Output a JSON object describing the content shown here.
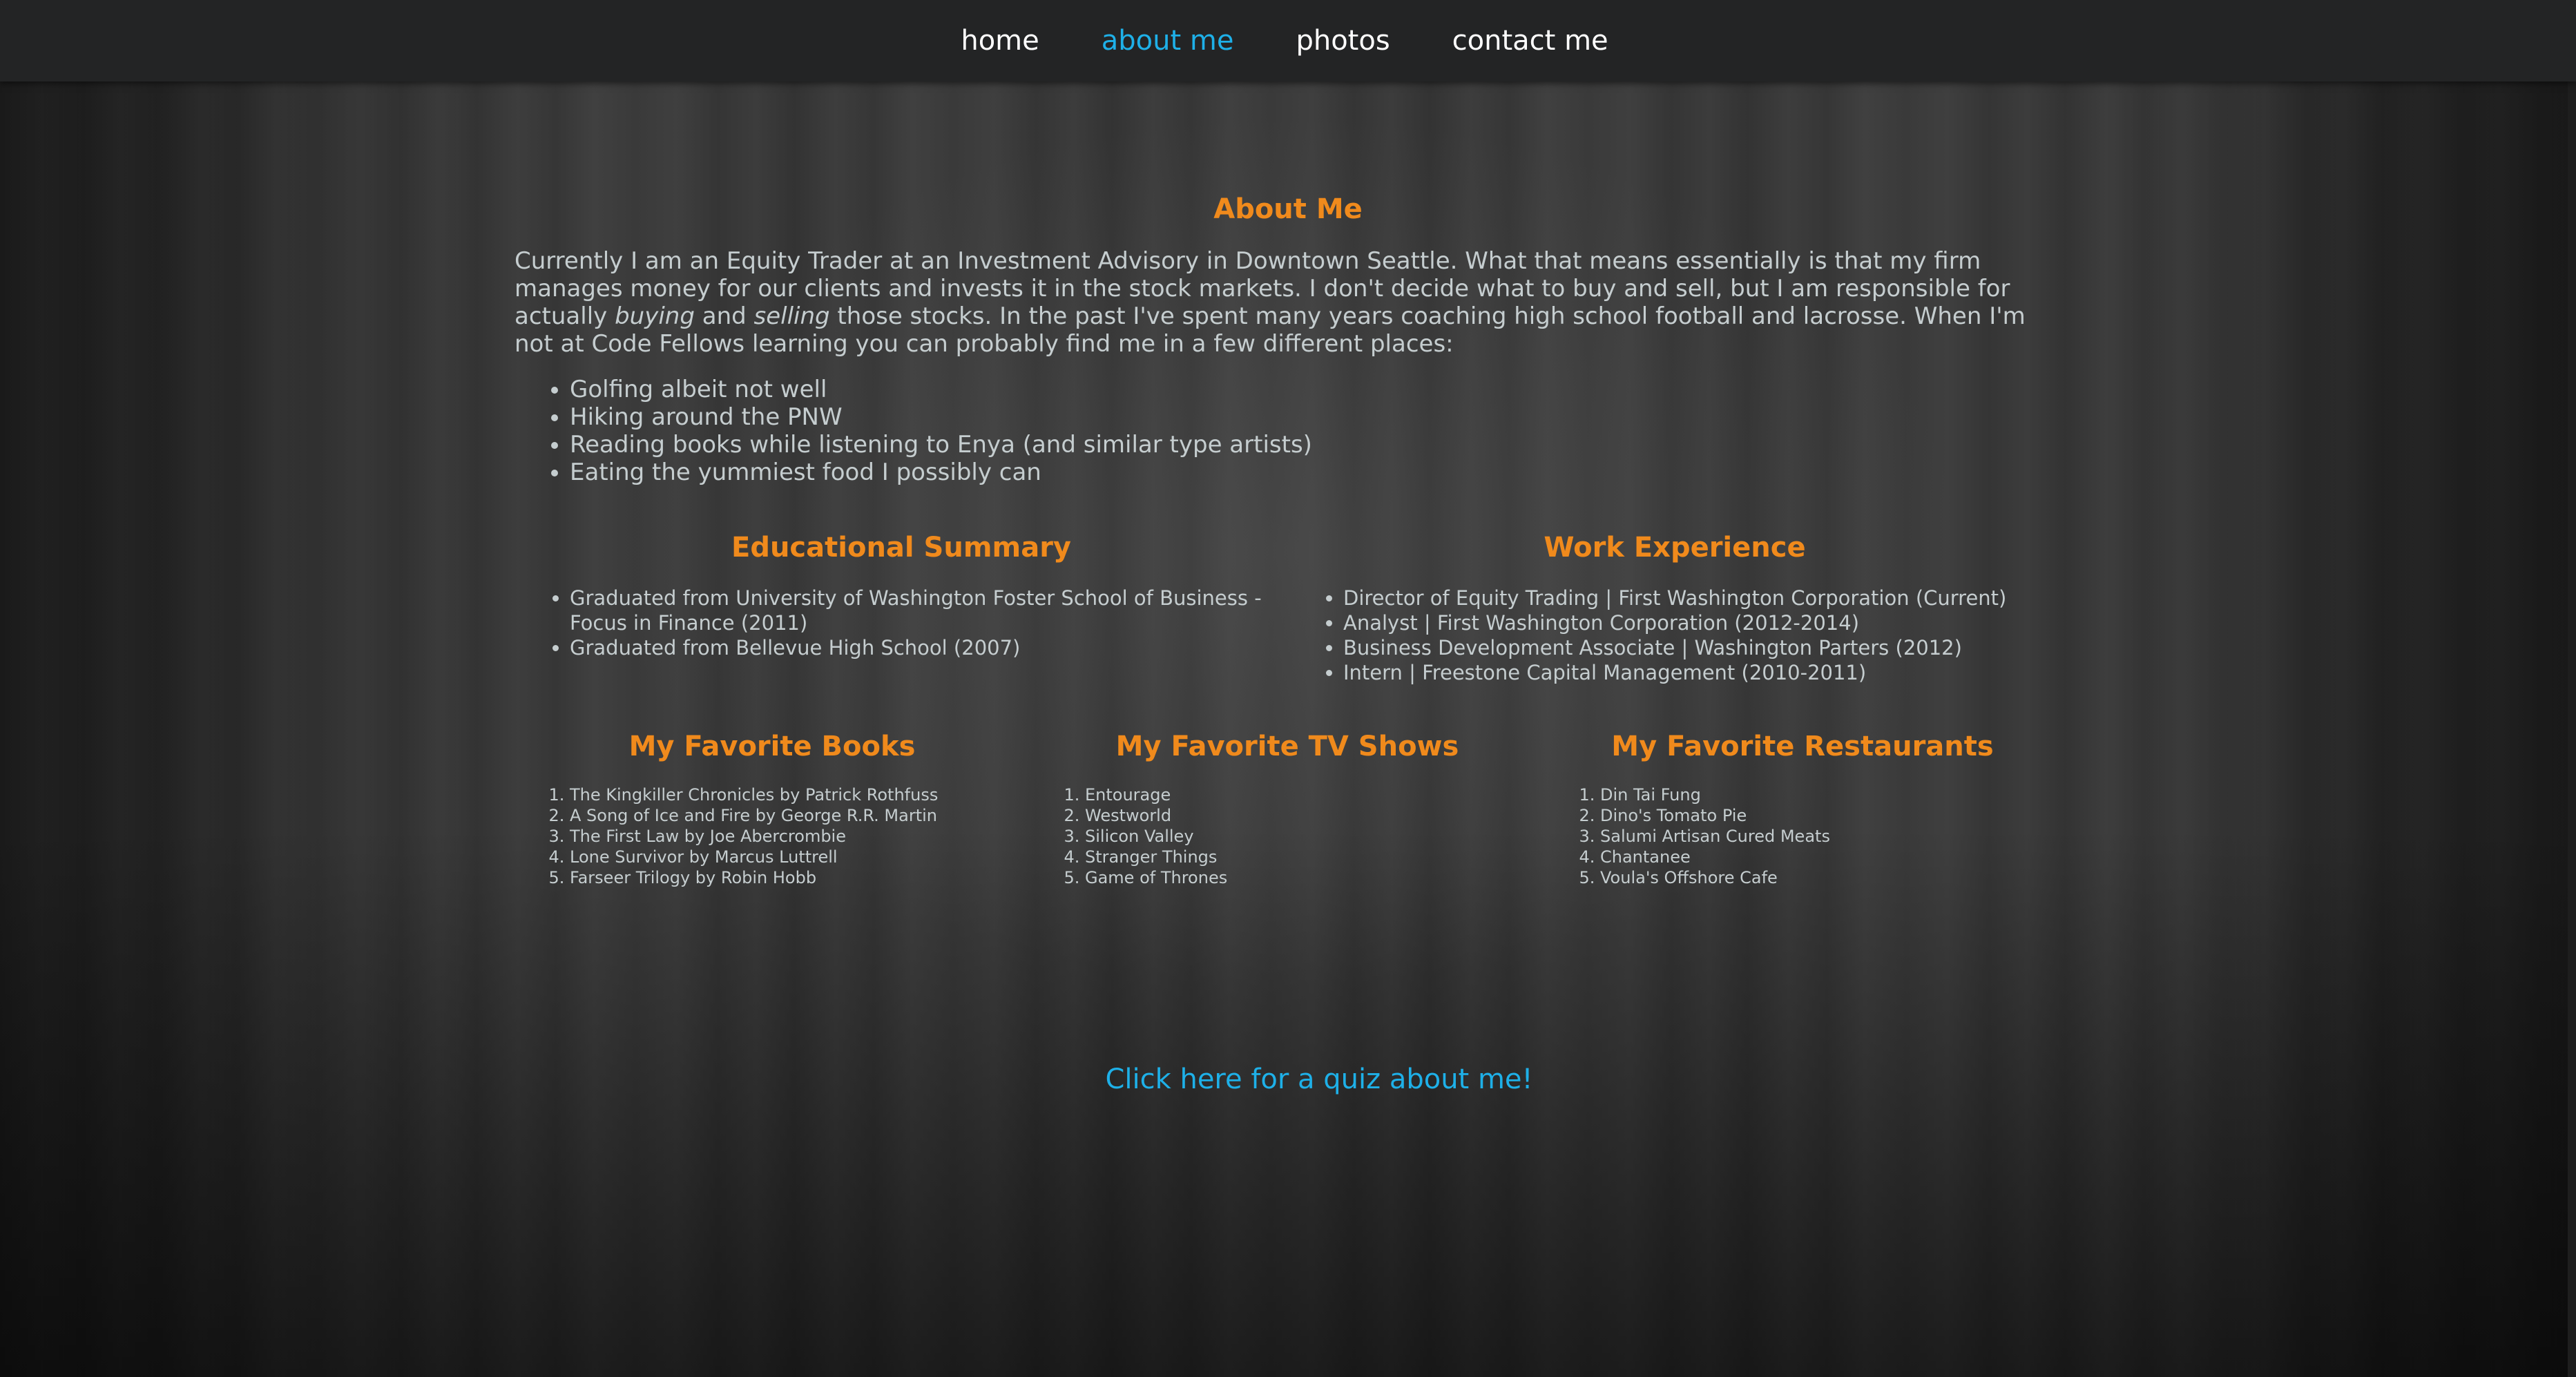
{
  "nav": {
    "items": [
      {
        "label": "home"
      },
      {
        "label": "about me"
      },
      {
        "label": "photos"
      },
      {
        "label": "contact me"
      }
    ],
    "active": "about me"
  },
  "about": {
    "title": "About Me",
    "intro_part1": "Currently I am an Equity Trader at an Investment Advisory in Downtown Seattle. What that means essentially is that my firm manages money for our clients and invests it in the stock markets. I don't decide what to buy and sell, but I am responsible for actually ",
    "intro_em1": "buying",
    "intro_and": " and ",
    "intro_em2": "selling",
    "intro_part2": " those stocks. In the past I've spent many years coaching high school football and lacrosse. When I'm not at Code Fellows learning you can probably find me in a few different places:",
    "places": [
      "Golfing albeit not well",
      "Hiking around the PNW",
      "Reading books while listening to Enya (and similar type artists)",
      "Eating the yummiest food I possibly can"
    ]
  },
  "education": {
    "title": "Educational Summary",
    "items": [
      "Graduated from University of Washington Foster School of Business - Focus in Finance (2011)",
      "Graduated from Bellevue High School (2007)"
    ]
  },
  "work": {
    "title": "Work Experience",
    "items": [
      "Director of Equity Trading | First Washington Corporation (Current)",
      "Analyst | First Washington Corporation (2012-2014)",
      "Business Development Associate | Washington Parters (2012)",
      "Intern | Freestone Capital Management (2010-2011)"
    ]
  },
  "books": {
    "title": "My Favorite Books",
    "items": [
      "The Kingkiller Chronicles by Patrick Rothfuss",
      "A Song of Ice and Fire by George R.R. Martin",
      "The First Law by Joe Abercrombie",
      "Lone Survivor by Marcus Luttrell",
      "Farseer Trilogy by Robin Hobb"
    ]
  },
  "tv": {
    "title": "My Favorite TV Shows",
    "items": [
      "Entourage",
      "Westworld",
      "Silicon Valley",
      "Stranger Things",
      "Game of Thrones"
    ]
  },
  "restaurants": {
    "title": "My Favorite Restaurants",
    "items": [
      "Din Tai Fung",
      "Dino's Tomato Pie",
      "Salumi Artisan Cured Meats",
      "Chantanee",
      "Voula's Offshore Cafe"
    ]
  },
  "quiz_link": "Click here for a quiz about me!",
  "colors": {
    "accent_orange": "#f08a1c",
    "link_blue": "#1eb0e8",
    "nav_bg": "#232425",
    "text": "#c5cdcf"
  }
}
